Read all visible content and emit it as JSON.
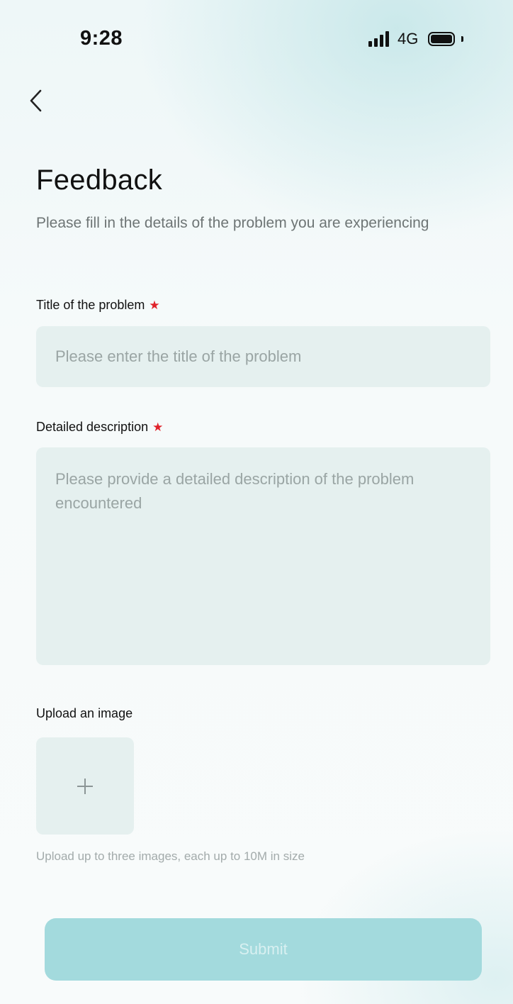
{
  "status_bar": {
    "time": "9:28",
    "network": "4G"
  },
  "header": {
    "back_icon": "chevron-left-icon",
    "title": "Feedback",
    "subtitle": "Please fill in the details of the problem you are experiencing"
  },
  "form": {
    "title_field": {
      "label": "Title of the problem",
      "required_mark": "★",
      "value": "",
      "placeholder": "Please enter the title of the problem"
    },
    "description_field": {
      "label": "Detailed description",
      "required_mark": "★",
      "value": "",
      "placeholder": "Please provide a detailed description of the problem encountered"
    },
    "upload": {
      "label": "Upload an image",
      "add_icon": "plus-icon",
      "hint": "Upload up to three images, each up to 10M in size"
    },
    "submit_label": "Submit"
  },
  "colors": {
    "accent": "#a3dadd",
    "required": "#e0222a",
    "input_background": "#e5f0ef"
  }
}
